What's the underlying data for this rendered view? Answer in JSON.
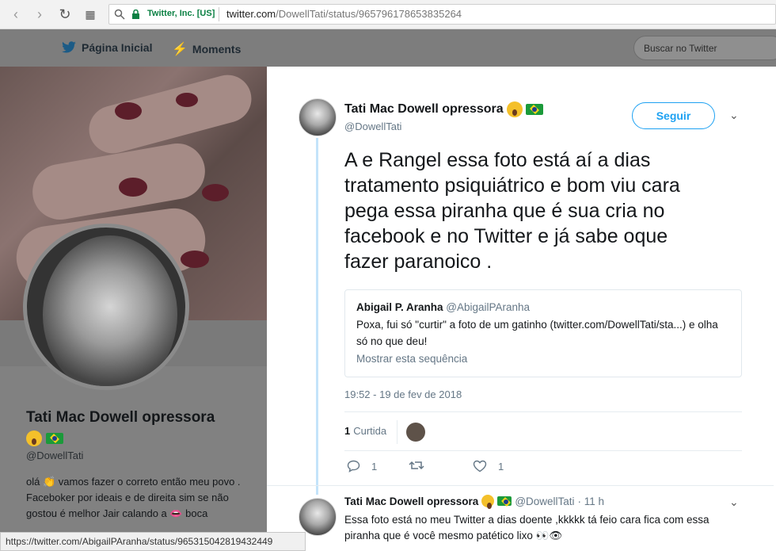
{
  "browser": {
    "secure_label": "Twitter, Inc. [US]",
    "url_host": "twitter.com",
    "url_path": "/DowellTati/status/965796178653835264",
    "status_url": "https://twitter.com/AbigailPAranha/status/965315042819432449"
  },
  "twitter_nav": {
    "home_label": "Página Inicial",
    "moments_label": "Moments",
    "search_placeholder": "Buscar no Twitter"
  },
  "profile": {
    "name": "Tati Mac Dowell opressora",
    "handle": "@DowellTati",
    "bio": "olá 👏 vamos fazer o correto então meu povo . Faceboker por ideais e de direita sim se não gostou é melhor Jair calando a 👄 boca"
  },
  "tweet": {
    "author_name": "Tati Mac Dowell opressora",
    "author_handle": "@DowellTati",
    "follow_label": "Seguir",
    "text": "A e Rangel essa foto está aí a dias tratamento psiquiátrico e bom viu cara pega essa piranha que é sua cria no facebook e no Twitter e já sabe oque fazer paranoico .",
    "timestamp": "19:52 - 19 de fev de 2018",
    "likes_count": "1",
    "likes_label": "Curtida",
    "reply_count": "1",
    "like_action_count": "1"
  },
  "quoted": {
    "name": "Abigail P. Aranha",
    "handle": "@AbigailPAranha",
    "text": "Poxa, fui só \"curtir\" a foto de um gatinho (twitter.com/DowellTati/sta...) e olha só no que deu!",
    "link_label": "Mostrar esta sequência"
  },
  "reply": {
    "author_name": "Tati Mac Dowell opressora",
    "author_handle": "@DowellTati",
    "age": "· 11 h",
    "text": "Essa foto está no meu Twitter a dias doente ,kkkkk tá feio cara fica com essa piranha que é você mesmo patético lixo 👀👁"
  },
  "colors": {
    "accent": "#1da1f2",
    "secure_green": "#0b8043",
    "thread_line": "#c4e4fa"
  }
}
